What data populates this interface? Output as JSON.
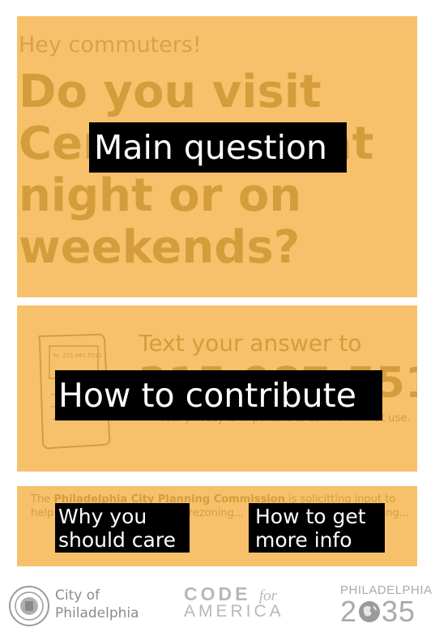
{
  "panels": {
    "question": {
      "eyebrow": "Hey commuters!",
      "question": "Do you visit Center City at night or on weekends?",
      "overlay_label": "Main question"
    },
    "contribute": {
      "text_line": "Text your answer to",
      "phone_number": "215.987.5511",
      "privacy_note": "Your privacy is important to us. We will not use.",
      "phone_sketch_text": "To: 215.987.5511",
      "overlay_label": "How to contribute"
    },
    "info": {
      "body_start": "The ",
      "org": "Philadelphia City Planning Commission",
      "body_mid": " is solicitting input to help shape the district's ",
      "body_bold": "new",
      "body_end": " rezoning... summer 2012. philaplanning...",
      "why_label": "Why you should care",
      "more_info_label": "How to get more info"
    }
  },
  "footer": {
    "city_line1": "City of",
    "city_line2": "Philadelphia",
    "cfa_code": "CODE",
    "cfa_for": "for",
    "cfa_america": "AMERICA",
    "phl_top": "PHILADELPHIA",
    "phl_year_a": "2",
    "phl_year_b": "35"
  }
}
